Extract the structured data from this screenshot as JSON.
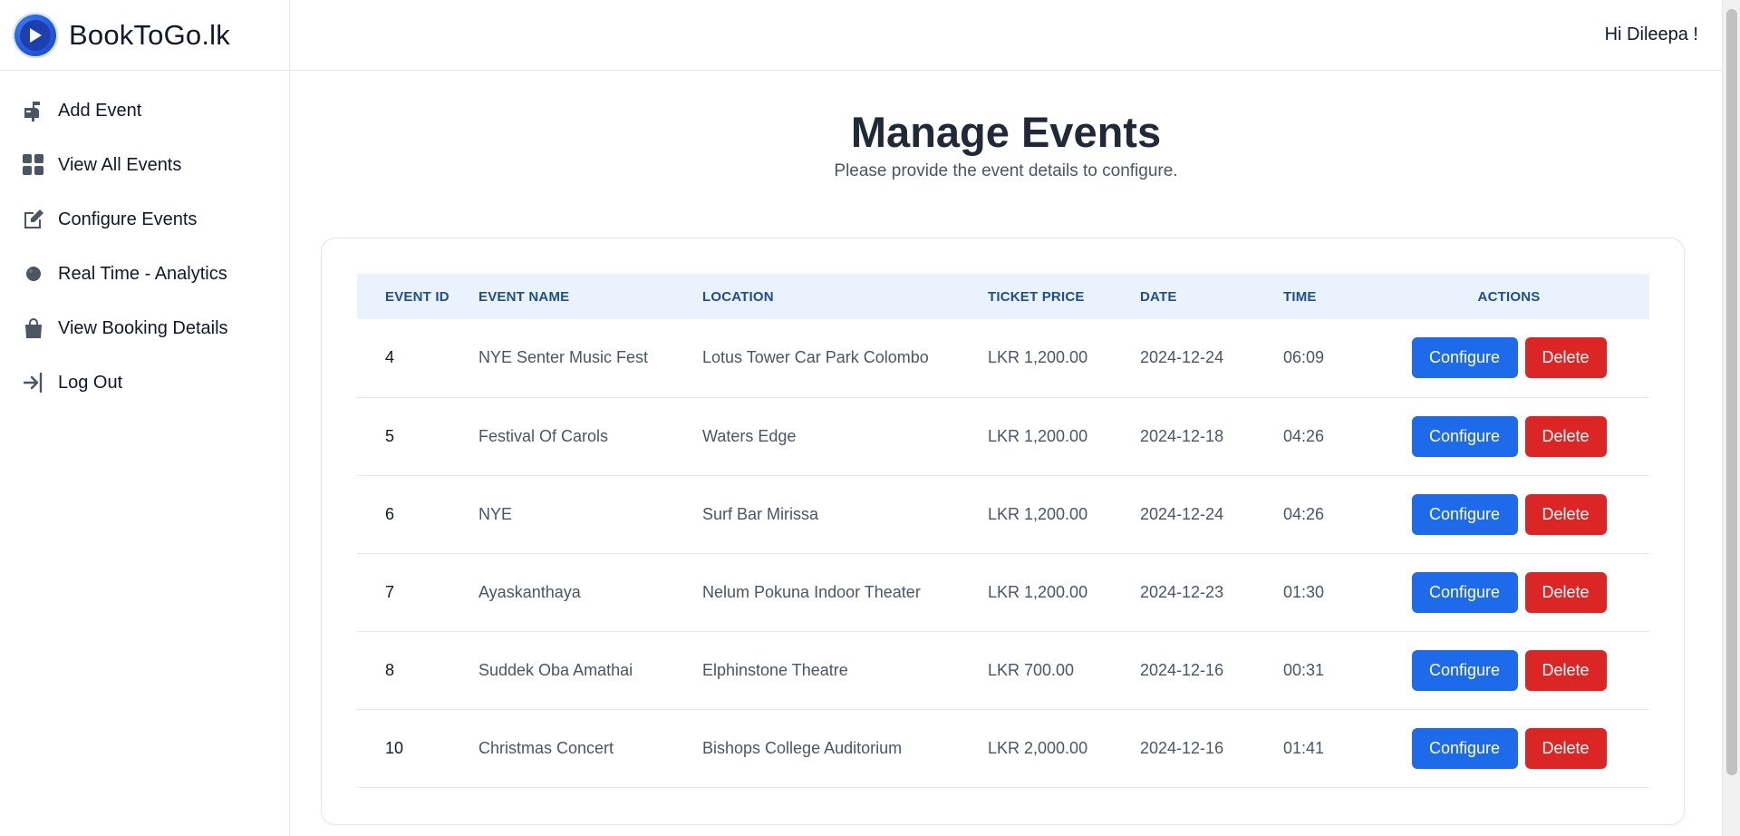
{
  "brand": {
    "name": "BookToGo.lk"
  },
  "header": {
    "greeting": "Hi Dileepa !"
  },
  "sidebar": {
    "items": [
      {
        "label": "Add Event",
        "icon": "mailbox-icon"
      },
      {
        "label": "View All Events",
        "icon": "grid-icon"
      },
      {
        "label": "Configure Events",
        "icon": "edit-icon"
      },
      {
        "label": "Real Time - Analytics",
        "icon": "analytics-dot-icon"
      },
      {
        "label": "View Booking Details",
        "icon": "shopping-bag-icon"
      },
      {
        "label": "Log Out",
        "icon": "logout-icon"
      }
    ]
  },
  "main": {
    "title": "Manage Events",
    "subtitle": "Please provide the event details to configure."
  },
  "table": {
    "headers": {
      "id": "EVENT ID",
      "name": "EVENT NAME",
      "location": "LOCATION",
      "price": "TICKET PRICE",
      "date": "DATE",
      "time": "TIME",
      "actions": "ACTIONS"
    },
    "rows": [
      {
        "id": "4",
        "name": "NYE Senter Music Fest",
        "location": "Lotus Tower Car Park Colombo",
        "price": "LKR 1,200.00",
        "date": "2024-12-24",
        "time": "06:09",
        "configure": "Configure",
        "delete": "Delete"
      },
      {
        "id": "5",
        "name": "Festival Of Carols",
        "location": "Waters Edge",
        "price": "LKR 1,200.00",
        "date": "2024-12-18",
        "time": "04:26",
        "configure": "Configure",
        "delete": "Delete"
      },
      {
        "id": "6",
        "name": "NYE",
        "location": "Surf Bar Mirissa",
        "price": "LKR 1,200.00",
        "date": "2024-12-24",
        "time": "04:26",
        "configure": "Configure",
        "delete": "Delete"
      },
      {
        "id": "7",
        "name": "Ayaskanthaya",
        "location": "Nelum Pokuna Indoor Theater",
        "price": "LKR 1,200.00",
        "date": "2024-12-23",
        "time": "01:30",
        "configure": "Configure",
        "delete": "Delete"
      },
      {
        "id": "8",
        "name": "Suddek Oba Amathai",
        "location": "Elphinstone Theatre",
        "price": "LKR 700.00",
        "date": "2024-12-16",
        "time": "00:31",
        "configure": "Configure",
        "delete": "Delete"
      },
      {
        "id": "10",
        "name": "Christmas Concert",
        "location": "Bishops College Auditorium",
        "price": "LKR 2,000.00",
        "date": "2024-12-16",
        "time": "01:41",
        "configure": "Configure",
        "delete": "Delete"
      }
    ]
  },
  "colors": {
    "primary_button": "#1d6bea",
    "danger_button": "#dc2626",
    "header_row_bg": "#eaf3fd",
    "header_text": "#1e4e8c"
  }
}
